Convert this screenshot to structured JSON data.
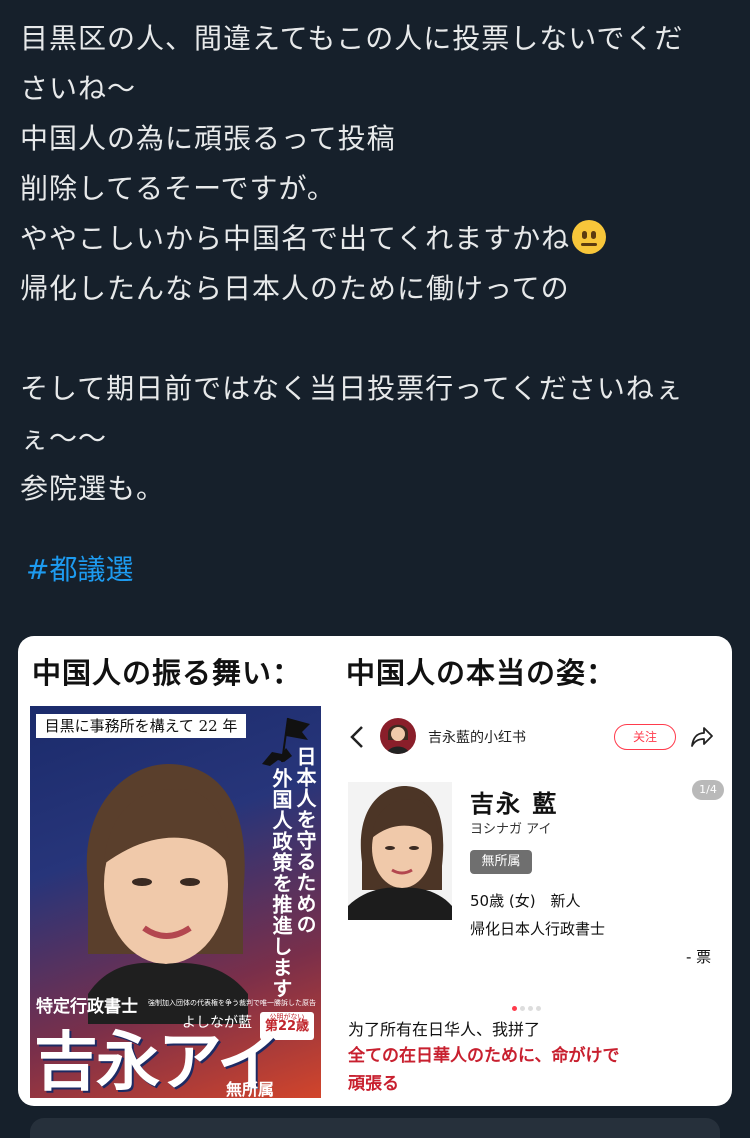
{
  "post": {
    "lines": [
      "目黒区の人、間違えてもこの人に投票しないでくだ",
      "さいね〜",
      "中国人の為に頑張るって投稿",
      "削除してるそーですが。",
      "ややこしいから中国名で出てくれますかね",
      "帰化したんなら日本人のために働けっての",
      "そして期日前ではなく当日投票行ってくださいねぇ",
      "ぇ〜〜",
      "参院選も。"
    ],
    "emoji": "neutral-face-icon",
    "hashtag": "#都議選"
  },
  "card": {
    "left_heading": "中国人の振る舞い：",
    "right_heading": "中国人の本当の姿：",
    "poster": {
      "banner": "目黒に事務所を構えて 22 年",
      "slogan_line1": "日本人を守るための",
      "slogan_line2": "外国人政策を推進します",
      "title": "特定行政書士",
      "note": "強制加入団体の代表権を争う裁判で唯一勝訴した原告",
      "kana": "よしなが藍",
      "badge_small": "公明がない",
      "badge_number": "第22歳",
      "name": "吉永アイ",
      "party": "無所属"
    },
    "profile": {
      "account": "吉永藍的小红书",
      "follow": "关注",
      "page": "1/4",
      "name": "吉永 藍",
      "kana": "ヨシナガ アイ",
      "party": "無所属",
      "age": "50歳 (女)　新人",
      "job": "帰化日本人行政書士",
      "votes": "- 票",
      "caption_zh": "为了所有在日华人、我拼了",
      "caption_jp_line1": "全ての在日華人のために、命がけで",
      "caption_jp_line2": "頑張る"
    }
  },
  "colors": {
    "background": "#16202b",
    "text": "#e7e9ea",
    "link": "#1d9bf0",
    "accent_red": "#ff3b4c"
  }
}
